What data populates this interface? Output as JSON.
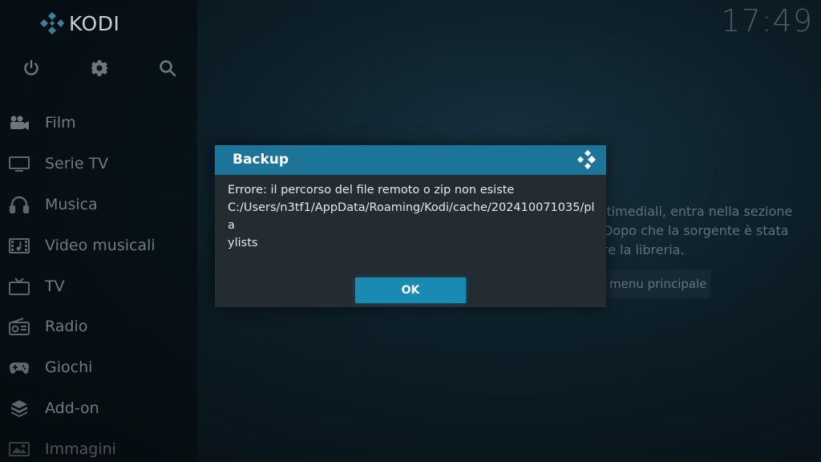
{
  "app": {
    "logo_text": "KODI",
    "clock": "17:49"
  },
  "top_icons": [
    "power-icon",
    "gear-icon",
    "search-icon"
  ],
  "menu": {
    "items": [
      {
        "label": "Film",
        "icon": "film-people-icon"
      },
      {
        "label": "Serie TV",
        "icon": "monitor-icon"
      },
      {
        "label": "Musica",
        "icon": "headphones-icon"
      },
      {
        "label": "Video musicali",
        "icon": "music-video-icon"
      },
      {
        "label": "TV",
        "icon": "tv-icon"
      },
      {
        "label": "Radio",
        "icon": "radio-icon"
      },
      {
        "label": "Giochi",
        "icon": "gamepad-icon"
      },
      {
        "label": "Add-on",
        "icon": "addon-box-icon"
      },
      {
        "label": "Immagini",
        "icon": "image-icon"
      }
    ]
  },
  "background_info": {
    "line1": "ltimediali, entra nella sezione",
    "line2": "Dopo che la sorgente è stata",
    "line3": "re la libreria.",
    "button_label": "menu principale"
  },
  "dialog": {
    "title": "Backup",
    "message_line1": "Errore: il percorso del file remoto o zip non esiste",
    "message_line2": "C:/Users/n3tf1/AppData/Roaming/Kodi/cache/202410071035/pla",
    "message_line3": "ylists",
    "ok_label": "OK"
  },
  "colors": {
    "header_blue": "#1c7598",
    "button_blue": "#1a8ab3",
    "dialog_bg": "#222c31",
    "sidebar_text": "#6f7b82"
  }
}
